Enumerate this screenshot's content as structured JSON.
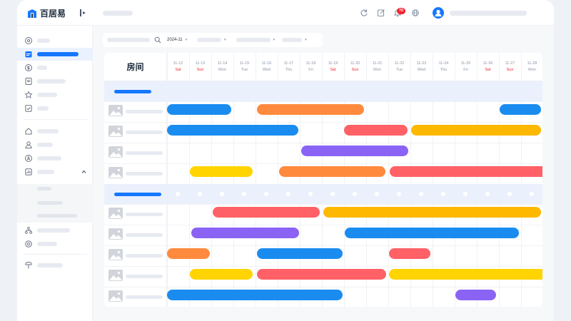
{
  "app": {
    "brand": "百居易",
    "notification_count": "70",
    "colors": {
      "accent": "#1677ff",
      "weekend": "#f5222d"
    }
  },
  "header": {
    "icons": [
      "refresh-icon",
      "edit-icon",
      "bell-icon",
      "globe-icon",
      "user-icon"
    ]
  },
  "sidebar": {
    "icons": [
      "at-icon",
      "calendar-icon",
      "dollar-icon",
      "document-icon",
      "star-icon",
      "checkbox-icon",
      "home-icon",
      "person-icon",
      "a-circle-icon",
      "chart-icon",
      "chevron-up-icon",
      "org-icon",
      "settings-icon",
      "pin-icon"
    ]
  },
  "filters": {
    "month": "2024-11",
    "caret": "▾"
  },
  "calendar": {
    "room_header": "房间",
    "dates": [
      {
        "md": "11-12",
        "wd": "Sat",
        "weekend": true
      },
      {
        "md": "11-13",
        "wd": "Sun",
        "weekend": true
      },
      {
        "md": "11-14",
        "wd": "Mon",
        "weekend": false
      },
      {
        "md": "11-15",
        "wd": "Tue",
        "weekend": false
      },
      {
        "md": "11-16",
        "wd": "Wed",
        "weekend": false
      },
      {
        "md": "11-17",
        "wd": "Thu",
        "weekend": false
      },
      {
        "md": "11-18",
        "wd": "Fri",
        "weekend": false
      },
      {
        "md": "11-19",
        "wd": "Sat",
        "weekend": true
      },
      {
        "md": "11-20",
        "wd": "Sun",
        "weekend": true
      },
      {
        "md": "11-21",
        "wd": "Mon",
        "weekend": false
      },
      {
        "md": "11-22",
        "wd": "Tue",
        "weekend": false
      },
      {
        "md": "11-23",
        "wd": "Wed",
        "weekend": false
      },
      {
        "md": "11-24",
        "wd": "Thu",
        "weekend": false
      },
      {
        "md": "11-25",
        "wd": "Fri",
        "weekend": false
      },
      {
        "md": "11-26",
        "wd": "Sat",
        "weekend": true
      },
      {
        "md": "11-27",
        "wd": "Sun",
        "weekend": true
      },
      {
        "md": "11-28",
        "wd": "Mon",
        "weekend": false
      }
    ],
    "booking_colors": {
      "blue": "#1a8cf0",
      "orange": "#ff8a3d",
      "red": "#ff6166",
      "amber": "#ffb800",
      "purple": "#8a63f5",
      "yellow": "#ffd400"
    }
  }
}
